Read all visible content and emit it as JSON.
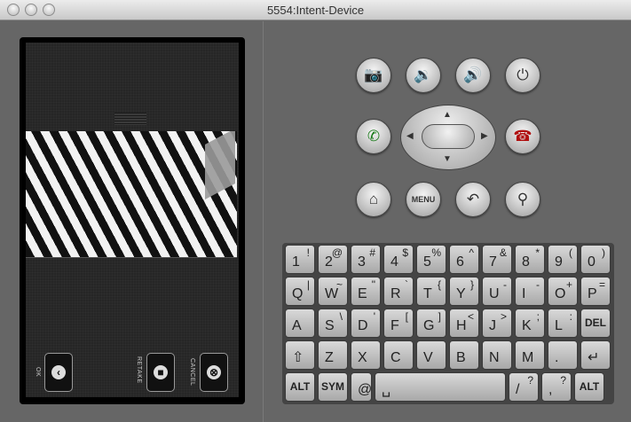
{
  "window": {
    "title": "5554:Intent-Device"
  },
  "camera": {
    "ok_label": "OK",
    "retake_label": "RETAKE",
    "cancel_label": "CANCEL"
  },
  "controls": {
    "row1": [
      "camera-icon",
      "volume-down-icon",
      "volume-up-icon",
      "power-icon"
    ],
    "menu_label": "MENU"
  },
  "keyboard": {
    "row1": [
      [
        "1",
        "!"
      ],
      [
        "2",
        "@"
      ],
      [
        "3",
        "#"
      ],
      [
        "4",
        "$"
      ],
      [
        "5",
        "%"
      ],
      [
        "6",
        "^"
      ],
      [
        "7",
        "&"
      ],
      [
        "8",
        "*"
      ],
      [
        "9",
        "("
      ],
      [
        "0",
        ")"
      ]
    ],
    "row2": [
      [
        "Q",
        "|"
      ],
      [
        "W",
        "~"
      ],
      [
        "E",
        "\""
      ],
      [
        "R",
        "`"
      ],
      [
        "T",
        "{"
      ],
      [
        "Y",
        "}"
      ],
      [
        "U",
        "-"
      ],
      [
        "I",
        "-"
      ],
      [
        "O",
        "+"
      ],
      [
        "P",
        "="
      ]
    ],
    "row3": [
      [
        "A",
        ""
      ],
      [
        "S",
        "\\"
      ],
      [
        "D",
        "'"
      ],
      [
        "F",
        "["
      ],
      [
        "G",
        "]"
      ],
      [
        "H",
        "<"
      ],
      [
        "J",
        ">"
      ],
      [
        "K",
        ";"
      ],
      [
        "L",
        ":"
      ],
      [
        "DEL",
        ""
      ]
    ],
    "row4": [
      [
        "⇧",
        ""
      ],
      [
        "Z",
        ""
      ],
      [
        "X",
        ""
      ],
      [
        "C",
        ""
      ],
      [
        "V",
        ""
      ],
      [
        "B",
        ""
      ],
      [
        "N",
        ""
      ],
      [
        "M",
        ""
      ],
      [
        ".",
        ""
      ],
      [
        "↵",
        ""
      ]
    ],
    "row5": [
      [
        "ALT",
        ""
      ],
      [
        "SYM",
        ""
      ],
      [
        "@",
        ""
      ],
      [
        "␣",
        ""
      ],
      [
        "/",
        "?"
      ],
      [
        ",",
        "?"
      ],
      [
        "ALT",
        ""
      ]
    ]
  }
}
